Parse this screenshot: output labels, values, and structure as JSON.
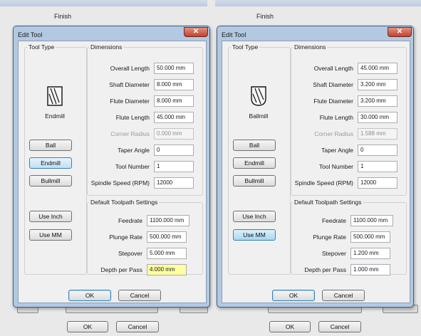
{
  "background": {
    "title_left": "Finish",
    "title_right": "Finish",
    "ok_left": "OK",
    "cancel_left": "Cancel",
    "ok_right": "OK",
    "cancel_right": "Cancel"
  },
  "dialogs": [
    {
      "title": "Edit Tool",
      "close_glyph": "✕",
      "tool_type": {
        "group_label": "Tool Type",
        "icon": "endmill-icon",
        "name": "Endmill",
        "buttons": [
          "Ball",
          "Endmill",
          "Bullmill"
        ],
        "selected": "Endmill"
      },
      "units": {
        "inch": "Use Inch",
        "mm": "Use MM",
        "selected": "none"
      },
      "dimensions": {
        "group_label": "Dimensions",
        "overall_length": {
          "label": "Overall Length",
          "value": "50.000 mm"
        },
        "shaft_diameter": {
          "label": "Shaft Diameter",
          "value": "8.000 mm"
        },
        "flute_diameter": {
          "label": "Flute Diameter",
          "value": "8.000 mm"
        },
        "flute_length": {
          "label": "Flute Length",
          "value": "45.000 mm"
        },
        "corner_radius": {
          "label": "Corner Radius",
          "value": "0.000 mm"
        },
        "taper_angle": {
          "label": "Taper Angle",
          "value": "0"
        },
        "tool_number": {
          "label": "Tool Number",
          "value": "1"
        },
        "spindle_speed": {
          "label": "Spindle Speed (RPM)",
          "value": "12000"
        }
      },
      "toolpath": {
        "group_label": "Default Toolpath Settings",
        "feedrate": {
          "label": "Feedrate",
          "value": "1100.000 mm"
        },
        "plunge_rate": {
          "label": "Plunge Rate",
          "value": "500.000 mm"
        },
        "stepover": {
          "label": "Stepover",
          "value": "5.000 mm"
        },
        "depth_per_pass": {
          "label": "Depth per Pass",
          "value": "4.000 mm"
        }
      },
      "ok": "OK",
      "cancel": "Cancel"
    },
    {
      "title": "Edit Tool",
      "close_glyph": "✕",
      "tool_type": {
        "group_label": "Tool Type",
        "icon": "ballmill-icon",
        "name": "Ballmill",
        "buttons": [
          "Ball",
          "Endmill",
          "Bullmill"
        ],
        "selected": "none"
      },
      "units": {
        "inch": "Use Inch",
        "mm": "Use MM",
        "selected": "Use MM"
      },
      "dimensions": {
        "group_label": "Dimensions",
        "overall_length": {
          "label": "Overall Length",
          "value": "45.000 mm"
        },
        "shaft_diameter": {
          "label": "Shaft Diameter",
          "value": "3.200 mm"
        },
        "flute_diameter": {
          "label": "Flute Diameter",
          "value": "3.200 mm"
        },
        "flute_length": {
          "label": "Flute Length",
          "value": "30.000 mm"
        },
        "corner_radius": {
          "label": "Corner Radius",
          "value": "1.588 mm"
        },
        "taper_angle": {
          "label": "Taper Angle",
          "value": "0"
        },
        "tool_number": {
          "label": "Tool Number",
          "value": "1"
        },
        "spindle_speed": {
          "label": "Spindle Speed (RPM)",
          "value": "12000"
        }
      },
      "toolpath": {
        "group_label": "Default Toolpath Settings",
        "feedrate": {
          "label": "Feedrate",
          "value": "1100.000 mm"
        },
        "plunge_rate": {
          "label": "Plunge Rate",
          "value": "500.000 mm"
        },
        "stepover": {
          "label": "Stepover",
          "value": "1.200 mm"
        },
        "depth_per_pass": {
          "label": "Depth per Pass",
          "value": "1.000 mm"
        }
      },
      "ok": "OK",
      "cancel": "Cancel"
    }
  ],
  "colors": {
    "dialog_frame": "#b3c9e2",
    "highlight_field": "#ffffa0",
    "selected_button": "#a9d7f2",
    "close_button": "#c2422f"
  }
}
